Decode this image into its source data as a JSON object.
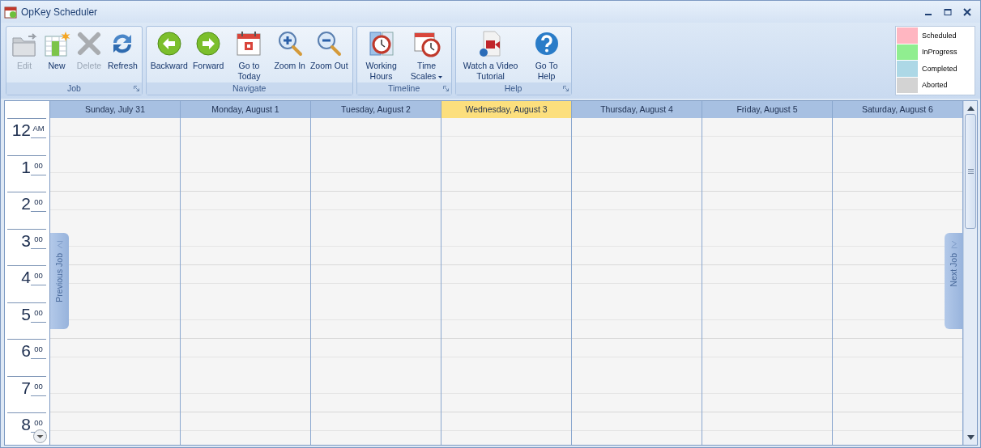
{
  "window": {
    "title": "OpKey Scheduler"
  },
  "ribbon": {
    "groups": [
      {
        "label": "Job",
        "launcher": true,
        "buttons": [
          {
            "kind": "edit",
            "label": "Edit",
            "disabled": true
          },
          {
            "kind": "new",
            "label": "New",
            "disabled": false
          },
          {
            "kind": "delete",
            "label": "Delete",
            "disabled": true
          },
          {
            "kind": "refresh",
            "label": "Refresh",
            "disabled": false
          }
        ]
      },
      {
        "label": "Navigate",
        "launcher": false,
        "buttons": [
          {
            "kind": "backward",
            "label": "Backward",
            "disabled": false
          },
          {
            "kind": "forward",
            "label": "Forward",
            "disabled": false
          },
          {
            "kind": "today",
            "label": "Go to Today",
            "disabled": false
          },
          {
            "kind": "zoom_in",
            "label": "Zoom In",
            "disabled": false
          },
          {
            "kind": "zoom_out",
            "label": "Zoom Out",
            "disabled": false
          }
        ]
      },
      {
        "label": "Timeline",
        "launcher": true,
        "buttons": [
          {
            "kind": "working_hours",
            "label": "Working Hours",
            "disabled": false
          },
          {
            "kind": "time_scales",
            "label": "Time Scales",
            "disabled": false,
            "dropdown": true
          }
        ]
      },
      {
        "label": "Help",
        "launcher": true,
        "buttons": [
          {
            "kind": "video",
            "label": "Watch a Video Tutorial",
            "disabled": false
          },
          {
            "kind": "help",
            "label": "Go To Help",
            "disabled": false
          }
        ]
      }
    ]
  },
  "legend": [
    {
      "label": "Scheduled",
      "color": "#ffb6c1"
    },
    {
      "label": "InProgress",
      "color": "#90ee90"
    },
    {
      "label": "Completed",
      "color": "#add8e6"
    },
    {
      "label": "Aborted",
      "color": "#d3d3d3"
    }
  ],
  "calendar": {
    "days": [
      {
        "label": "Sunday, July 31",
        "selected": false
      },
      {
        "label": "Monday, August 1",
        "selected": false
      },
      {
        "label": "Tuesday, August 2",
        "selected": false
      },
      {
        "label": "Wednesday, August 3",
        "selected": true
      },
      {
        "label": "Thursday, August 4",
        "selected": false
      },
      {
        "label": "Friday, August 5",
        "selected": false
      },
      {
        "label": "Saturday, August 6",
        "selected": false
      }
    ],
    "hours": [
      {
        "hour": "12",
        "suffix": "AM"
      },
      {
        "hour": "1",
        "suffix": "00"
      },
      {
        "hour": "2",
        "suffix": "00"
      },
      {
        "hour": "3",
        "suffix": "00"
      },
      {
        "hour": "4",
        "suffix": "00"
      },
      {
        "hour": "5",
        "suffix": "00"
      },
      {
        "hour": "6",
        "suffix": "00"
      },
      {
        "hour": "7",
        "suffix": "00"
      },
      {
        "hour": "8",
        "suffix": "00"
      }
    ],
    "previous_tab": "Previous Job",
    "next_tab": "Next Job"
  }
}
